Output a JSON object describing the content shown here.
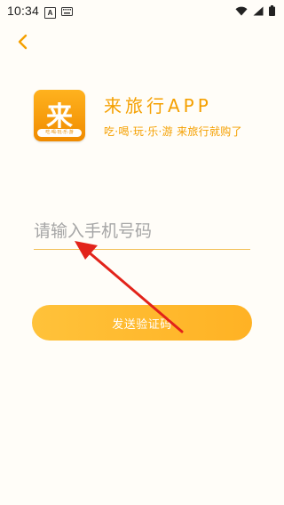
{
  "status_bar": {
    "time": "10:34",
    "notification_icon_letter": "A",
    "icons": [
      "notification-a-icon",
      "keyboard-icon",
      "wifi-icon",
      "cellular-signal-icon",
      "battery-icon"
    ]
  },
  "header": {
    "back_icon": "chevron-left-icon"
  },
  "brand": {
    "logo_char": "来",
    "logo_subtitle": "吃·喝·玩·乐·游",
    "title": "来旅行APP",
    "tagline": "吃·喝·玩·乐·游 来旅行就购了"
  },
  "login": {
    "phone_placeholder": "请输入手机号码",
    "phone_value": "",
    "send_code_label": "发送验证码"
  },
  "colors": {
    "accent": "#f5a000",
    "button": "#ffb82c",
    "underline": "#f2bf55",
    "annotation_arrow": "#e2231a"
  }
}
